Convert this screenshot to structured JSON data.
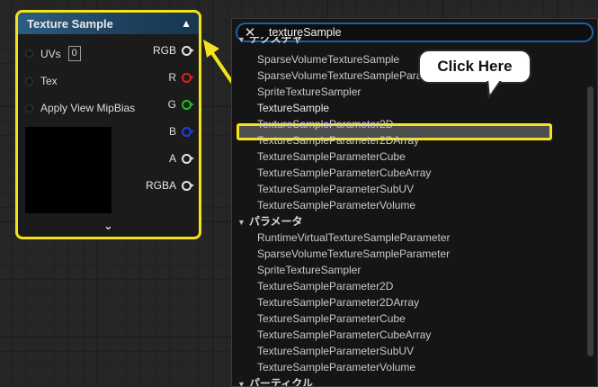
{
  "node": {
    "title": "Texture Sample",
    "inputs": [
      {
        "label": "UVs",
        "value": "0"
      },
      {
        "label": "Tex"
      },
      {
        "label": "Apply View MipBias"
      }
    ],
    "outputs": [
      {
        "label": "RGB",
        "color": "#e6e6e6"
      },
      {
        "label": "R",
        "color": "#e02020"
      },
      {
        "label": "G",
        "color": "#20c020"
      },
      {
        "label": "B",
        "color": "#2040e0"
      },
      {
        "label": "A",
        "color": "#e6e6e6"
      },
      {
        "label": "RGBA",
        "color": "#e6e6e6"
      }
    ]
  },
  "search": {
    "value": "textureSample"
  },
  "results": {
    "cut_category": "テクスチャ",
    "group1": [
      "SparseVolumeTextureSample",
      "SparseVolumeTextureSampleParameter",
      "SpriteTextureSampler",
      "TextureSample",
      "TextureSampleParameter2D",
      "TextureSampleParameter2DArray",
      "TextureSampleParameterCube",
      "TextureSampleParameterCubeArray",
      "TextureSampleParameterSubUV",
      "TextureSampleParameterVolume"
    ],
    "category2": "パラメータ",
    "group2": [
      "RuntimeVirtualTextureSampleParameter",
      "SparseVolumeTextureSampleParameter",
      "SpriteTextureSampler",
      "TextureSampleParameter2D",
      "TextureSampleParameter2DArray",
      "TextureSampleParameterCube",
      "TextureSampleParameterCubeArray",
      "TextureSampleParameterSubUV",
      "TextureSampleParameterVolume"
    ],
    "category3": "パーティクル"
  },
  "callout": {
    "text": "Click Here"
  },
  "colors": {
    "highlight": "#f5e31a",
    "search_border": "#1a5fa8"
  }
}
